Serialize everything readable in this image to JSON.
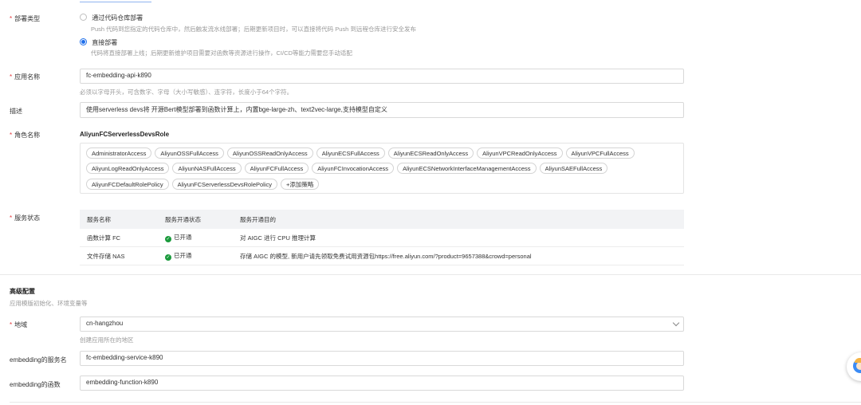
{
  "deploy_type": {
    "label": "部署类型",
    "options": [
      {
        "title": "通过代码仓库部署",
        "desc": "Push 代码到您指定的代码仓库中，然后触发流水线部署；后期更新项目时，可以直接将代码 Push 到远程仓库进行安全发布",
        "checked": false
      },
      {
        "title": "直接部署",
        "desc": "代码将直接部署上线；后期更新维护项目需要对函数等资源进行操作，CI/CD等能力需要您手动适配",
        "checked": true
      }
    ]
  },
  "app_name": {
    "label": "应用名称",
    "value": "fc-embedding-api-k890",
    "help": "必须以字母开头，可含数字、字母（大小写敏感）、连字符，长度小于64个字符。"
  },
  "description": {
    "label": "描述",
    "value": "使用serverless devs将 开源Bert模型部署到函数计算上，内置bge-large-zh、text2vec-large,支持模型自定义"
  },
  "role": {
    "label": "角色名称",
    "value": "AliyunFCServerlessDevsRole",
    "policies": [
      "AdministratorAccess",
      "AliyunOSSFullAccess",
      "AliyunOSSReadOnlyAccess",
      "AliyunECSFullAccess",
      "AliyunECSReadOnlyAccess",
      "AliyunVPCReadOnlyAccess",
      "AliyunVPCFullAccess",
      "AliyunLogReadOnlyAccess",
      "AliyunNASFullAccess",
      "AliyunFCFullAccess",
      "AliyunFCInvocationAccess",
      "AliyunECSNetworkInterfaceManagementAccess",
      "AliyunSAEFullAccess",
      "AliyunFCDefaultRolePolicy",
      "AliyunFCServerlessDevsRolePolicy"
    ],
    "add_label": "+添加策略"
  },
  "service_status": {
    "label": "服务状态",
    "headers": [
      "服务名称",
      "服务开通状态",
      "服务开通目的"
    ],
    "rows": [
      {
        "name": "函数计算 FC",
        "status": "已开通",
        "purpose": "对 AIGC 进行 CPU 推理计算"
      },
      {
        "name": "文件存储 NAS",
        "status": "已开通",
        "purpose": "存储 AIGC 的模型, 新用户请先领取免费试用资源包https://free.aliyun.com/?product=9657388&crowd=personal"
      }
    ]
  },
  "advanced": {
    "title": "高级配置",
    "subtitle": "应用模版初始化、环境变量等"
  },
  "region": {
    "label": "地域",
    "value": "cn-hangzhou",
    "help": "创建应用所在的地区"
  },
  "embedding_service": {
    "label": "embedding的服务名",
    "value": "fc-embedding-service-k890"
  },
  "embedding_function": {
    "label": "embedding的函数",
    "value": "embedding-function-k890"
  },
  "colors": {
    "accent": "#1f6feb",
    "required": "#e4393c",
    "success": "#1a9a3c"
  }
}
